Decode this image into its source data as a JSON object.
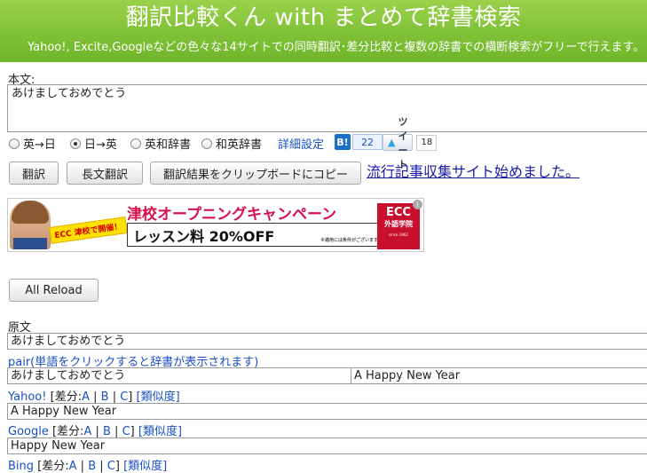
{
  "header": {
    "title": "翻訳比較くん with まとめて辞書検索",
    "subtitle": "Yahoo!, Excite,Googleなどの色々な14サイトでの同時翻訳･差分比較と複数の辞書での横断検索がフリーで行えます。"
  },
  "input": {
    "label": "本文:",
    "value": "あけましておめでとう"
  },
  "options": {
    "radios": [
      {
        "label": "英→日",
        "checked": false
      },
      {
        "label": "日→英",
        "checked": true
      },
      {
        "label": "英和辞書",
        "checked": false
      },
      {
        "label": "和英辞書",
        "checked": false
      }
    ],
    "settings_link": "詳細設定",
    "hatena_label": "B!",
    "hatena_count": "22",
    "tweet_label": "ツイート",
    "tweet_count": "18"
  },
  "buttons": {
    "translate": "翻訳",
    "long_translate": "長文翻訳",
    "copy": "翻訳結果をクリップボードにコピー",
    "news_link": "流行記事収集サイト始めました。",
    "reload": "All Reload"
  },
  "ad": {
    "badge": "ECC 津校で開催！",
    "headline": "津校オープニングキャンペーン",
    "price": "レッスン料 20%OFF",
    "fine_print": "※適用には条件がございます",
    "logo_main": "ECC",
    "logo_sub": "外語学院",
    "logo_since": "since 1962",
    "info": "i"
  },
  "results": {
    "source_label": "原文",
    "source_text": "あけましておめでとう",
    "pair_label": "pair(単語をクリックすると辞書が表示されます)",
    "pair_left": "あけましておめでとう",
    "pair_right": "A Happy New Year",
    "yahoo": {
      "name": "Yahoo!",
      "diff_prefix": "[差分:",
      "a": "A",
      "sep1": " | ",
      "b": "B",
      "sep2": " | ",
      "c": "C",
      "diff_suffix": "]",
      "similarity": "[類似度]",
      "text": "A Happy New Year"
    },
    "google": {
      "name": "Google",
      "diff_prefix": "[差分:",
      "a": "A",
      "sep1": " | ",
      "b": "B",
      "sep2": " | ",
      "c": "C",
      "diff_suffix": "]",
      "similarity": "[類似度]",
      "text": "Happy New Year"
    },
    "bing": {
      "name": "Bing",
      "diff_prefix": "[差分:",
      "a": "A",
      "sep1": " | ",
      "b": "B",
      "sep2": " | ",
      "c": "C",
      "diff_suffix": "]",
      "similarity": "[類似度]"
    }
  }
}
